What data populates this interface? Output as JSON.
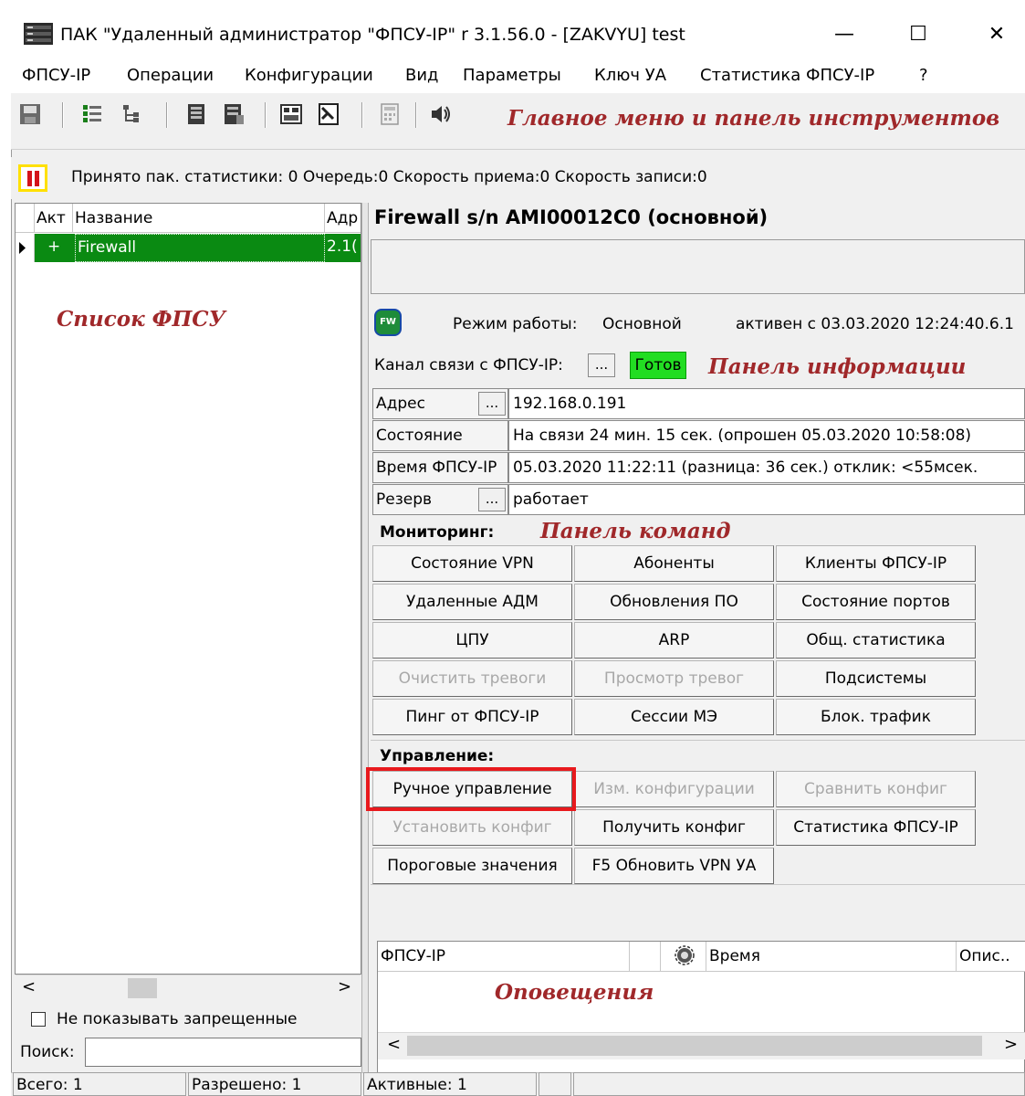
{
  "window": {
    "title": "ПАК \"Удаленный администратор \"ФПСУ-IP\" r 3.1.56.0 - [ZAKVYU] test",
    "minimize": "—",
    "maximize": "☐",
    "close": "✕"
  },
  "menu": [
    "ФПСУ-IP",
    "Операции",
    "Конфигурации",
    "Вид",
    "Параметры",
    "Ключ УА",
    "Статистика ФПСУ-IP",
    "?"
  ],
  "toolbar": {
    "icons": [
      "save-icon",
      "list-view-icon",
      "tree-view-icon",
      "device-icon",
      "device-config-icon",
      "config-icon",
      "document-icon",
      "calculator-icon",
      "sound-icon"
    ],
    "annotation": "Главное меню и панель инструментов"
  },
  "stats": {
    "text": "Принято пак. статистики: 0 Очередь:0 Скорость приема:0 Скорость записи:0"
  },
  "fpsu_list": {
    "columns": [
      "Акт",
      "Название",
      "Адр"
    ],
    "rows": [
      {
        "active": "+",
        "name": "Firewall",
        "address": "2.1("
      }
    ],
    "annotation": "Список ФПСУ",
    "hide_forbidden": "Не показывать запрещенные",
    "search_label": "Поиск:",
    "search_value": ""
  },
  "info": {
    "title": "Firewall s/n AMI00012C0 (основной)",
    "icon_text": "FW",
    "mode_label": "Режим работы:",
    "mode_value": "Основной",
    "active_since": "активен с 03.03.2020 12:24:40.6.1",
    "channel_label": "Канал связи с ФПСУ-IP:",
    "channel_btn": "...",
    "channel_status": "Готов",
    "annotation": "Панель информации",
    "properties": [
      {
        "label": "Адрес",
        "has_btn": true,
        "value": "192.168.0.191"
      },
      {
        "label": "Состояние",
        "has_btn": false,
        "value": "На связи  24 мин. 15 сек.   (опрошен 05.03.2020 10:58:08)"
      },
      {
        "label": "Время ФПСУ-IP",
        "has_btn": false,
        "value": "05.03.2020 11:22:11  (разница: 36 сек.) отклик: <55мсек."
      },
      {
        "label": "Резерв",
        "has_btn": true,
        "value": "работает"
      }
    ],
    "btn_ellipsis": "..."
  },
  "commands": {
    "monitoring_label": "Мониторинг:",
    "annotation": "Панель команд",
    "monitoring": [
      [
        "Состояние VPN",
        "Абоненты",
        "Клиенты ФПСУ-IP"
      ],
      [
        "Удаленные АДМ",
        "Обновления ПО",
        "Состояние портов"
      ],
      [
        "ЦПУ",
        "ARP",
        "Общ. статистика"
      ],
      [
        "Очистить тревоги",
        "Просмотр тревог",
        "Подсистемы"
      ],
      [
        "Пинг от ФПСУ-IP",
        "Сессии МЭ",
        "Блок. трафик"
      ]
    ],
    "control_label": "Управление:",
    "control": [
      [
        "Ручное управление",
        "Изм. конфигурации",
        "Сравнить конфиг"
      ],
      [
        "Установить конфиг",
        "Получить конфиг",
        "Статистика ФПСУ-IP"
      ],
      [
        "Пороговые значения",
        "F5 Обновить VPN УА"
      ]
    ]
  },
  "notifications": {
    "columns": [
      "ФПСУ-IP",
      "",
      "",
      "Время",
      "Опис.."
    ],
    "annotation": "Оповещения"
  },
  "statusbar": {
    "total": "Всего: 1",
    "allowed": "Разрешено: 1",
    "active": "Активные: 1"
  },
  "scroll": {
    "left": "<",
    "right": ">"
  },
  "colors": {
    "selected_row": "#0a8a12",
    "ready": "#22dd22",
    "annotation": "#a0282a",
    "highlight": "#e8191d"
  }
}
